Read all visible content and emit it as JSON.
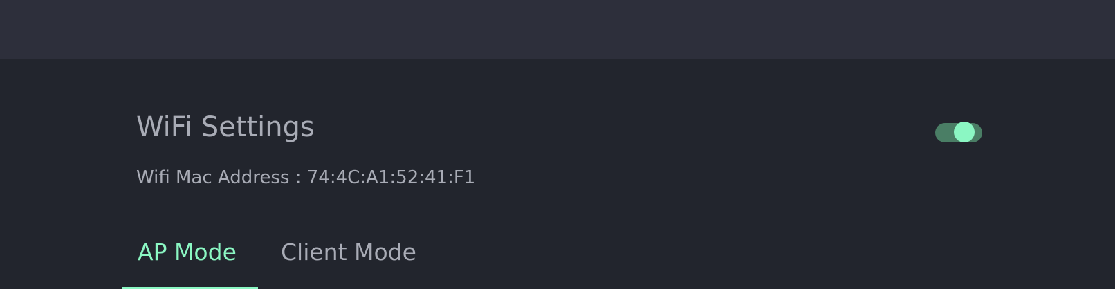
{
  "header": {},
  "wifi": {
    "title": "WiFi Settings",
    "mac_label": "Wifi Mac Address : 74:4C:A1:52:41:F1",
    "enabled": true,
    "toggle_color_on": "#8bf7c3"
  },
  "tabs": [
    {
      "label": "AP Mode",
      "active": true
    },
    {
      "label": "Client Mode",
      "active": false
    }
  ],
  "colors": {
    "accent": "#8bf7c3",
    "text": "#a9acb6",
    "background": "#22252d",
    "header": "#2d2f3b"
  }
}
